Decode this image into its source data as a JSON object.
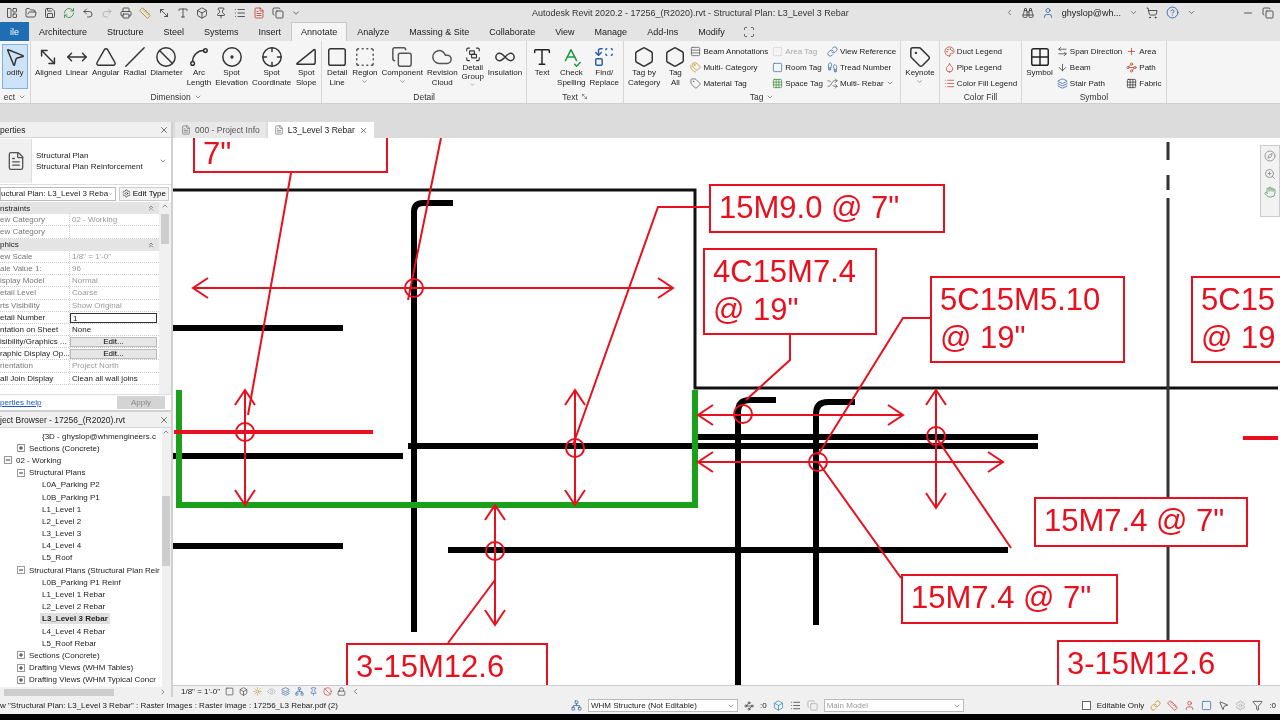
{
  "window": {
    "title": "Autodesk Revit 2020.2 - 17256_(R2020).rvt - Structural Plan: L3_Level 3 Rebar",
    "user": "ghyslop@wh..."
  },
  "ribbon_tabs": [
    {
      "label": "ile",
      "kind": "file",
      "selected": false
    },
    {
      "label": "Architecture",
      "kind": "tab",
      "selected": false
    },
    {
      "label": "Structure",
      "kind": "tab",
      "selected": false
    },
    {
      "label": "Steel",
      "kind": "tab",
      "selected": false
    },
    {
      "label": "Systems",
      "kind": "tab",
      "selected": false
    },
    {
      "label": "Insert",
      "kind": "tab",
      "selected": false
    },
    {
      "label": "Annotate",
      "kind": "tab",
      "selected": true
    },
    {
      "label": "Analyze",
      "kind": "tab",
      "selected": false
    },
    {
      "label": "Massing & Site",
      "kind": "tab",
      "selected": false
    },
    {
      "label": "Collaborate",
      "kind": "tab",
      "selected": false
    },
    {
      "label": "View",
      "kind": "tab",
      "selected": false
    },
    {
      "label": "Manage",
      "kind": "tab",
      "selected": false
    },
    {
      "label": "Add-Ins",
      "kind": "tab",
      "selected": false
    },
    {
      "label": "Modify",
      "kind": "tab",
      "selected": false
    }
  ],
  "ribbon_panels": [
    {
      "label": "ect",
      "dropdown": true,
      "launcher": false,
      "tools": [
        {
          "kind": "large",
          "label": "odify",
          "active": true
        }
      ]
    },
    {
      "label": "Dimension",
      "dropdown": true,
      "launcher": false,
      "tools": [
        {
          "kind": "large",
          "label": "Aligned"
        },
        {
          "kind": "large",
          "label": "Linear"
        },
        {
          "kind": "large",
          "label": "Angular"
        },
        {
          "kind": "large",
          "label": "Radial"
        },
        {
          "kind": "large",
          "label": "Diameter"
        },
        {
          "kind": "large",
          "label": "Arc\nLength"
        },
        {
          "kind": "large",
          "label": "Spot\nElevation"
        },
        {
          "kind": "large",
          "label": "Spot\nCoordinate"
        },
        {
          "kind": "large",
          "label": "Spot\nSlope"
        }
      ]
    },
    {
      "label": "Detail",
      "dropdown": false,
      "launcher": false,
      "tools": [
        {
          "kind": "large",
          "label": "Detail\nLine"
        },
        {
          "kind": "large",
          "label": "Region",
          "dropdown": true
        },
        {
          "kind": "large",
          "label": "Component",
          "dropdown": true
        },
        {
          "kind": "large",
          "label": "Revision\nCloud"
        },
        {
          "kind": "large",
          "label": "Detail\nGroup",
          "dropdown": true
        },
        {
          "kind": "large",
          "label": "Insulation"
        }
      ]
    },
    {
      "label": "Text",
      "dropdown": false,
      "launcher": true,
      "tools": [
        {
          "kind": "large",
          "label": "Text"
        },
        {
          "kind": "large",
          "label": "Check\nSpelling"
        },
        {
          "kind": "large",
          "label": "Find/\nReplace"
        }
      ]
    },
    {
      "label": "Tag",
      "dropdown": true,
      "launcher": false,
      "tools": [
        {
          "kind": "large",
          "label": "Tag by\nCategory"
        },
        {
          "kind": "large",
          "label": "Tag\nAll"
        },
        {
          "kind": "small",
          "label": "Beam Annotations"
        },
        {
          "kind": "small",
          "label": "Multi- Category"
        },
        {
          "kind": "small",
          "label": "Material Tag"
        },
        {
          "kind": "small",
          "label": "Area Tag",
          "disabled": true
        },
        {
          "kind": "small",
          "label": "Room Tag"
        },
        {
          "kind": "small",
          "label": "Space Tag"
        },
        {
          "kind": "small",
          "label": "View Reference"
        },
        {
          "kind": "small",
          "label": "Tread Number"
        },
        {
          "kind": "small",
          "label": "Multi- Rebar",
          "dropdown": true
        }
      ]
    },
    {
      "dropdown": false,
      "launcher": false,
      "tools": [
        {
          "kind": "large",
          "label": "Keynote",
          "dropdown": true
        }
      ]
    },
    {
      "label": "Color Fill",
      "dropdown": false,
      "launcher": false,
      "tools": [
        {
          "kind": "small",
          "label": "Duct Legend"
        },
        {
          "kind": "small",
          "label": "Pipe Legend"
        },
        {
          "kind": "small",
          "label": "Color Fill Legend"
        }
      ]
    },
    {
      "label": "Symbol",
      "dropdown": false,
      "launcher": false,
      "tools": [
        {
          "kind": "large",
          "label": "Symbol"
        },
        {
          "kind": "small",
          "label": "Span Direction"
        },
        {
          "kind": "small",
          "label": "Beam"
        },
        {
          "kind": "small",
          "label": "Stair Path"
        },
        {
          "kind": "small",
          "label": "Area"
        },
        {
          "kind": "small",
          "label": "Path"
        },
        {
          "kind": "small",
          "label": "Fabric"
        }
      ]
    }
  ],
  "properties": {
    "title": "perties",
    "type_name": "Structural Plan",
    "type_detail": "Structural Plan Reinforcement",
    "instance": "uctural Plan: L3_Level 3 Reba",
    "edit_type": "Edit Type",
    "rows": [
      {
        "kind": "group",
        "label": "nstraints"
      },
      {
        "kind": "text",
        "label": "ew Category",
        "value": "02 - Working",
        "disabled": true
      },
      {
        "kind": "text",
        "label": "ew Category",
        "disabled": true
      },
      {
        "kind": "group",
        "label": "phics"
      },
      {
        "kind": "text",
        "label": "ew Scale",
        "value": "1/8\" = 1'-0\"",
        "disabled": true
      },
      {
        "kind": "text",
        "label": "ale Value    1:",
        "value": "96",
        "disabled": true
      },
      {
        "kind": "text",
        "label": "isplay Model",
        "value": "Normal",
        "disabled": true
      },
      {
        "kind": "text",
        "label": "etail Level",
        "value": "Coarse",
        "disabled": true
      },
      {
        "kind": "text",
        "label": "rts Visibility",
        "value": "Show Original",
        "disabled": true
      },
      {
        "kind": "input",
        "label": "etail Number",
        "value": "1",
        "disabled": false
      },
      {
        "kind": "text",
        "label": "ntation on Sheet",
        "value": "None",
        "disabled": false
      },
      {
        "kind": "button",
        "label": "isibility/Graphics ...",
        "value": "Edit...",
        "disabled": false
      },
      {
        "kind": "button",
        "label": "raphic Display Op...",
        "value": "Edit...",
        "disabled": false
      },
      {
        "kind": "text",
        "label": "rientation",
        "value": "Project North",
        "disabled": true
      },
      {
        "kind": "text",
        "label": "all Join Display",
        "value": "Clean all wall joins",
        "disabled": false
      }
    ],
    "help_link": "perties help",
    "apply": {
      "label": "Apply",
      "disabled": true
    }
  },
  "project_browser": {
    "title": "ject Browser - 17256_(R2020).rvt",
    "tree": [
      {
        "children": [
          {
            "children": [
              {
                "label": "{3D - ghyslop@whmengineers.c",
                "selected": false
              }
            ]
          },
          {
            "label": "Sections (Concrete)",
            "expanded": false,
            "selected": false
          }
        ]
      },
      {
        "label": "02 - Working",
        "expanded": true,
        "selected": false,
        "children": [
          {
            "label": "Structural Plans",
            "expanded": true,
            "selected": false,
            "children": [
              {
                "label": "L0A_Parking P2",
                "selected": false
              },
              {
                "label": "L0B_Parking P1",
                "selected": false
              },
              {
                "label": "L1_Level 1",
                "selected": false
              },
              {
                "label": "L2_Level 2",
                "selected": false
              },
              {
                "label": "L3_Level 3",
                "selected": false
              },
              {
                "label": "L4_Level 4",
                "selected": false
              },
              {
                "label": "L5_Roof",
                "selected": false
              }
            ]
          },
          {
            "label": "Structural Plans (Structural Plan Reir",
            "expanded": true,
            "selected": false,
            "children": [
              {
                "label": "L0B_Parking P1 Reinf",
                "selected": false
              },
              {
                "label": "L1_Level 1 Rebar",
                "selected": false
              },
              {
                "label": "L2_Level 2 Rebar",
                "selected": false
              },
              {
                "label": "L3_Level 3 Rebar",
                "selected": true
              },
              {
                "label": "L4_Level 4 Rebar",
                "selected": false
              },
              {
                "label": "L5_Roof Rebar",
                "selected": false
              }
            ]
          },
          {
            "label": "Sections (Concrete)",
            "expanded": false,
            "selected": false
          },
          {
            "label": "Drafting Views (WHM Tables)",
            "expanded": false,
            "selected": false
          },
          {
            "label": "Drafting Views (WHM Typical Concr",
            "expanded": false,
            "selected": false
          }
        ]
      }
    ]
  },
  "view_tabs": [
    {
      "label": "000 - Project Info",
      "selected": false
    },
    {
      "label": "L3_Level 3 Rebar",
      "selected": true
    }
  ],
  "canvas": {
    "tags": [
      {
        "text": "7\""
      },
      {
        "text": "15M9.0 @ 7\""
      },
      {
        "text": "4C15M7.4\n@ 19\""
      },
      {
        "text": "5C15M5.10\n@ 19\""
      },
      {
        "text": "5C15\n@ 19"
      },
      {
        "text": "15M7.4 @ 7\""
      },
      {
        "text": "15M7.4 @ 7\""
      },
      {
        "text": "3-15M12.6"
      },
      {
        "text": "3-15M12.6"
      }
    ]
  },
  "view_control_bar": {
    "scale": "1/8\" = 1'-0\""
  },
  "status_bar": {
    "message": "w \"Structural Plan: L3_Level 3 Rebar\" : Raster Images : Raster image : 17256_L3 Rebar.pdf (2)",
    "workset": "WHM Structure (Not Editable)",
    "selection_count": ":0",
    "design_option": {
      "value": "Main Model",
      "disabled": true
    },
    "editable_only": {
      "label": "Editable Only",
      "checked": false
    },
    "filter_count": ":0"
  }
}
